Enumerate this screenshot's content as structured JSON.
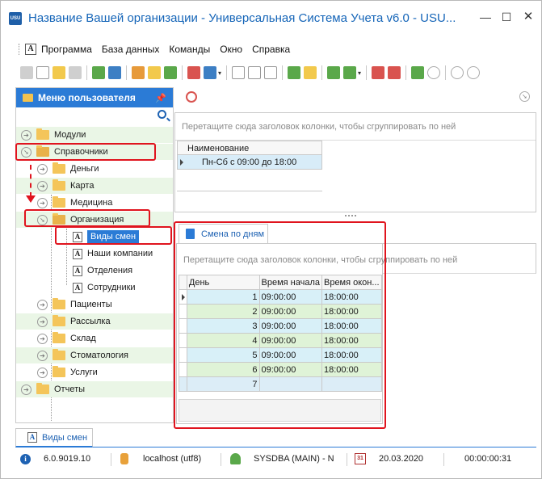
{
  "window": {
    "title": "Название Вашей организации - Универсальная Система Учета v6.0 - USU...",
    "app_icon_text": "USU",
    "min_glyph": "—",
    "max_glyph": "☐",
    "close_glyph": "✕"
  },
  "menu": {
    "icon_letter": "A",
    "items": [
      "Программа",
      "База данных",
      "Команды",
      "Окно",
      "Справка"
    ]
  },
  "left_panel": {
    "title": "Меню пользователя",
    "pin_glyph": "📌",
    "tree": [
      {
        "label": "Модули",
        "type": "folder",
        "level": 0,
        "expanded": false
      },
      {
        "label": "Справочники",
        "type": "folder",
        "level": 0,
        "expanded": true
      },
      {
        "label": "Деньги",
        "type": "folder",
        "level": 1,
        "expanded": false
      },
      {
        "label": "Карта",
        "type": "folder",
        "level": 1,
        "expanded": false
      },
      {
        "label": "Медицина",
        "type": "folder",
        "level": 1,
        "expanded": false
      },
      {
        "label": "Организация",
        "type": "folder",
        "level": 1,
        "expanded": true
      },
      {
        "label": "Виды смен",
        "type": "doc",
        "level": 2,
        "selected": true
      },
      {
        "label": "Наши компании",
        "type": "doc",
        "level": 2
      },
      {
        "label": "Отделения",
        "type": "doc",
        "level": 2
      },
      {
        "label": "Сотрудники",
        "type": "doc",
        "level": 2
      },
      {
        "label": "Пациенты",
        "type": "folder",
        "level": 1
      },
      {
        "label": "Рассылка",
        "type": "folder",
        "level": 1
      },
      {
        "label": "Склад",
        "type": "folder",
        "level": 1
      },
      {
        "label": "Стоматология",
        "type": "folder",
        "level": 1
      },
      {
        "label": "Услуги",
        "type": "folder",
        "level": 1
      },
      {
        "label": "Отчеты",
        "type": "folder",
        "level": 0
      }
    ]
  },
  "top_grid": {
    "group_hint": "Перетащите сюда заголовок колонки, чтобы сгруппировать по ней",
    "column": "Наименование",
    "rows": [
      "Пн-Сб с 09:00 до 18:00"
    ]
  },
  "detail": {
    "tab_label": "Смена по дням",
    "group_hint": "Перетащите сюда заголовок колонки, чтобы сгруппировать по ней",
    "columns": [
      "День",
      "Время начала",
      "Время окон..."
    ],
    "rows": [
      {
        "day": "1",
        "start": "09:00:00",
        "end": "18:00:00"
      },
      {
        "day": "2",
        "start": "09:00:00",
        "end": "18:00:00"
      },
      {
        "day": "3",
        "start": "09:00:00",
        "end": "18:00:00"
      },
      {
        "day": "4",
        "start": "09:00:00",
        "end": "18:00:00"
      },
      {
        "day": "5",
        "start": "09:00:00",
        "end": "18:00:00"
      },
      {
        "day": "6",
        "start": "09:00:00",
        "end": "18:00:00"
      }
    ],
    "new_row_day": "7"
  },
  "doc_tab": {
    "label": "Виды смен",
    "icon_letter": "A"
  },
  "status": {
    "version": "6.0.9019.10",
    "server": "localhost (utf8)",
    "user": "SYSDBA (MAIN) - N",
    "date": "20.03.2020",
    "calendar_day": "31",
    "timer": "00:00:00:31"
  },
  "colors": {
    "accent": "#2b7bd6",
    "title_blue": "#1565b8",
    "highlight_red": "#e0141e",
    "row_green": "#dff3d7",
    "row_blue": "#d8f0f8"
  }
}
